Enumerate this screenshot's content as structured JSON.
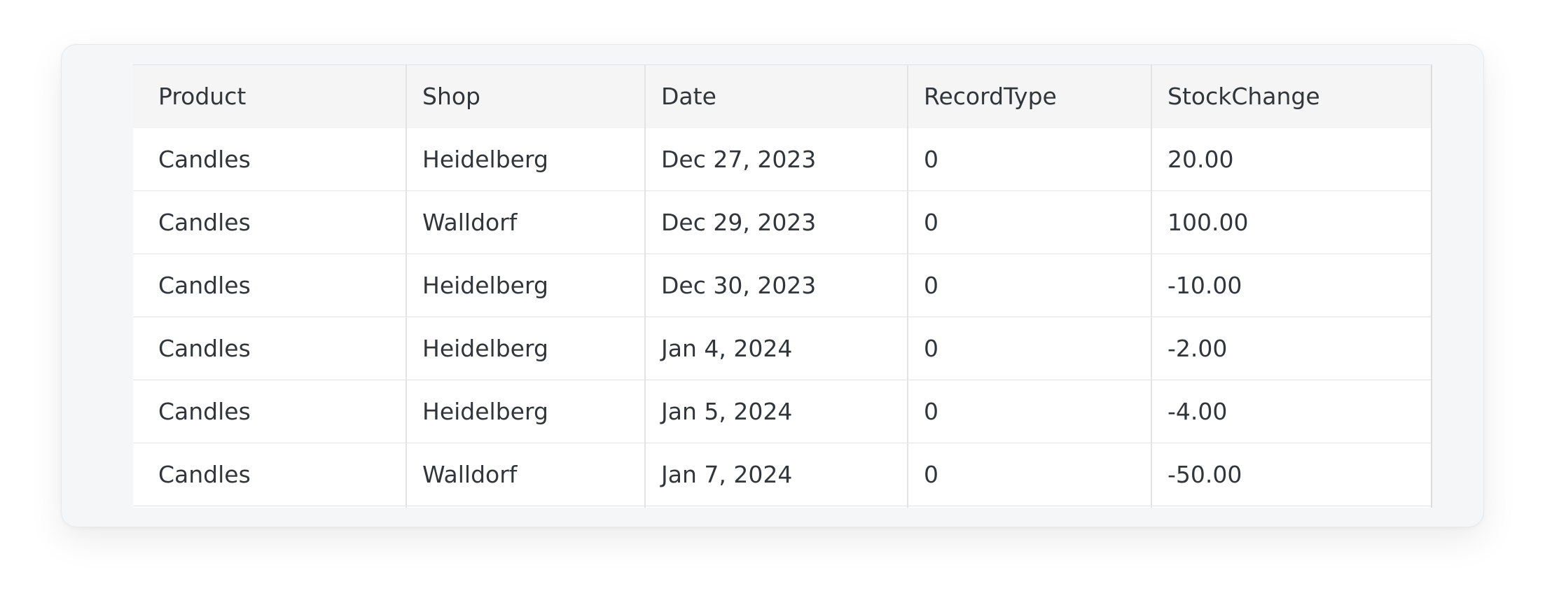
{
  "table": {
    "columns": [
      "Product",
      "Shop",
      "Date",
      "RecordType",
      "StockChange"
    ],
    "rows": [
      [
        "Candles",
        "Heidelberg",
        "Dec 27, 2023",
        "0",
        "20.00"
      ],
      [
        "Candles",
        "Walldorf",
        "Dec 29, 2023",
        "0",
        "100.00"
      ],
      [
        "Candles",
        "Heidelberg",
        "Dec 30, 2023",
        "0",
        "-10.00"
      ],
      [
        "Candles",
        "Heidelberg",
        "Jan 4, 2024",
        "0",
        "-2.00"
      ],
      [
        "Candles",
        "Heidelberg",
        "Jan 5, 2024",
        "0",
        "-4.00"
      ],
      [
        "Candles",
        "Walldorf",
        "Jan 7, 2024",
        "0",
        "-50.00"
      ],
      [
        "",
        "",
        "",
        "",
        ""
      ]
    ]
  }
}
